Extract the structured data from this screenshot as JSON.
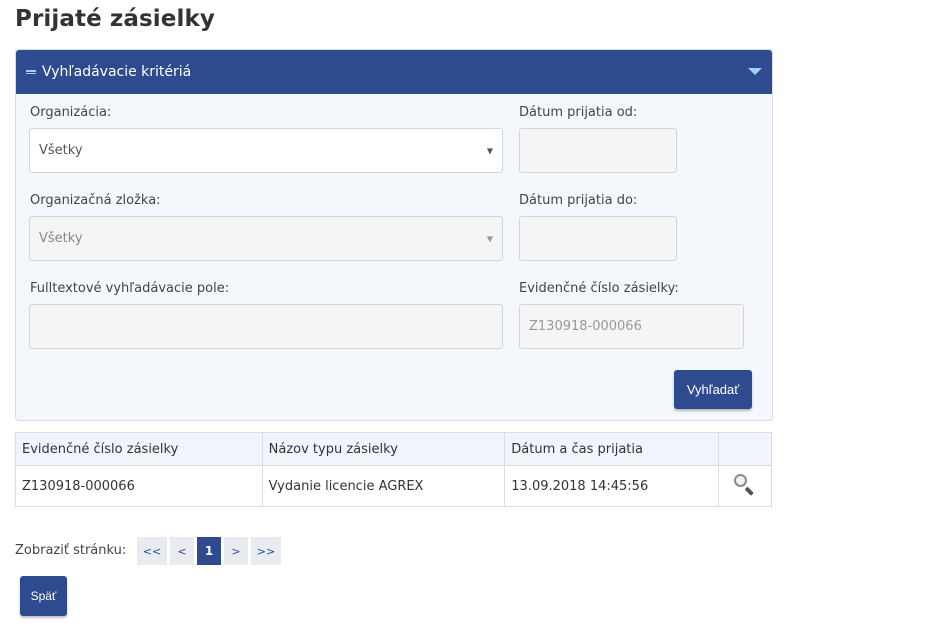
{
  "page": {
    "title": "Prijaté zásielky"
  },
  "search_panel": {
    "title": "Vyhľadávacie kritériá",
    "organization": {
      "label": "Organizácia:",
      "value": "Všetky"
    },
    "org_unit": {
      "label": "Organizačná zložka:",
      "value": "Všetky"
    },
    "fulltext": {
      "label": "Fulltextové vyhľadávacie pole:",
      "value": ""
    },
    "date_from": {
      "label": "Dátum prijatia od:",
      "value": ""
    },
    "date_to": {
      "label": "Dátum prijatia do:",
      "value": ""
    },
    "registration_no": {
      "label": "Evidenčné číslo zásielky:",
      "placeholder": "Z130918-000066"
    },
    "search_button": "Vyhľadať"
  },
  "table": {
    "headers": [
      "Evidenčné číslo zásielky",
      "Názov typu zásielky",
      "Dátum a čas prijatia",
      ""
    ],
    "rows": [
      {
        "number": "Z130918-000066",
        "type": "Vydanie licencie AGREX",
        "received": "13.09.2018 14:45:56",
        "icon": "magnifier-icon"
      }
    ]
  },
  "pagination": {
    "label": "Zobraziť stránku:",
    "first": "<<",
    "prev": "<",
    "current": "1",
    "next": ">",
    "last": ">>"
  },
  "back_button": "Späť",
  "colors": {
    "primary": "#2f4b8f",
    "panel_bg": "#f4f7fc",
    "accent_light": "#9fd0ff"
  }
}
